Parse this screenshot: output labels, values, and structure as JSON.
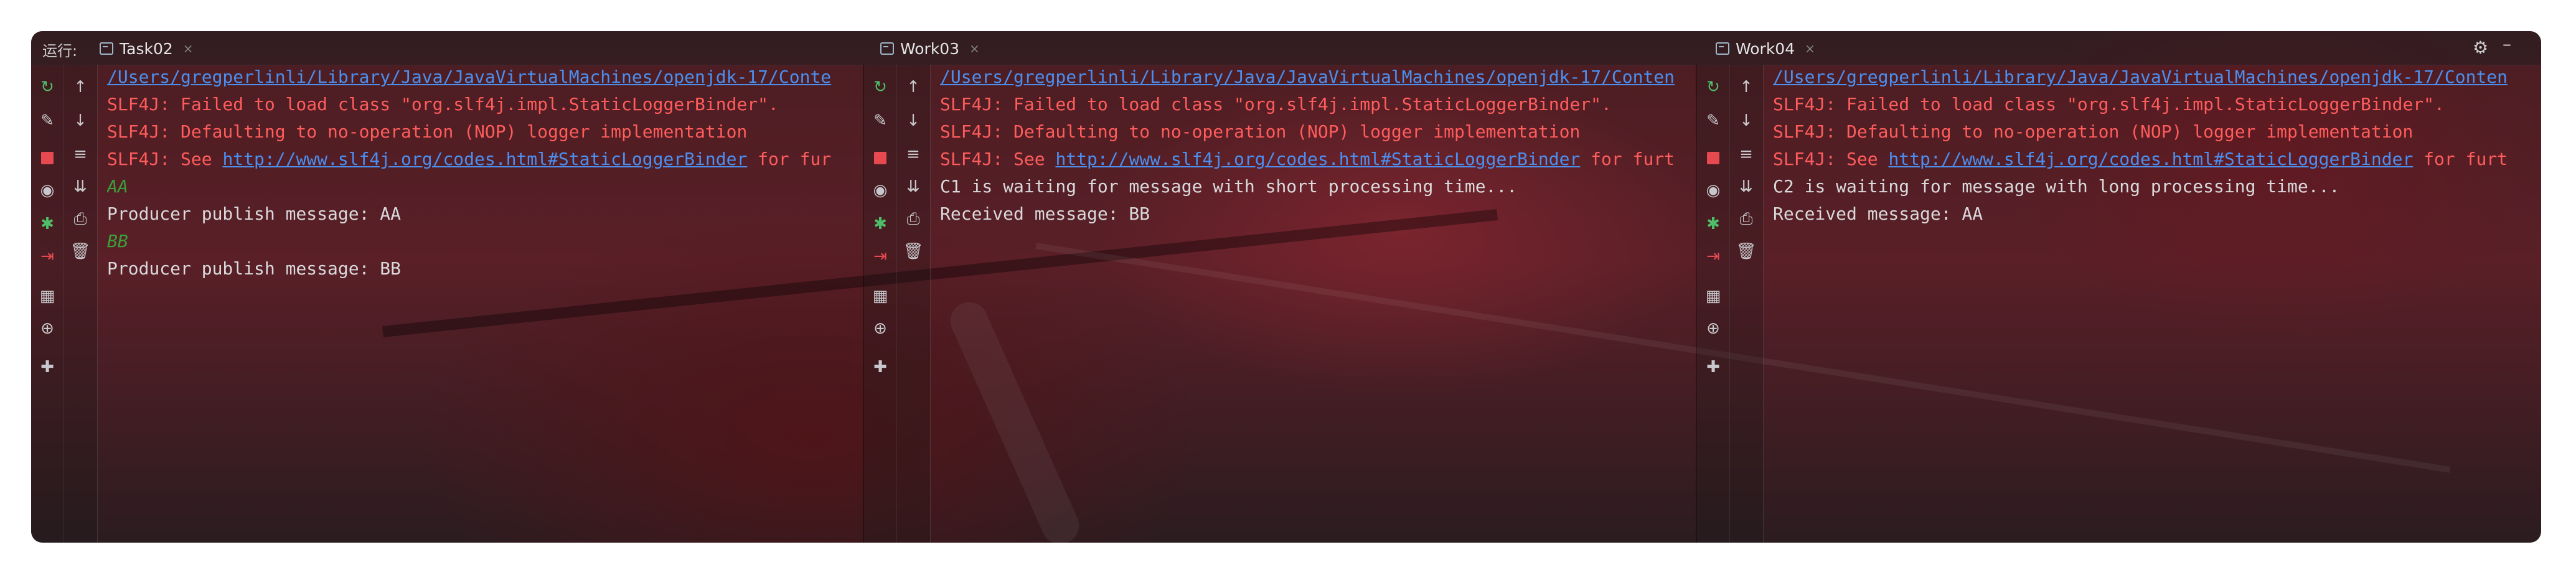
{
  "run_label": "运行:",
  "tabs": [
    {
      "label": "Task02",
      "close": "×"
    },
    {
      "label": "Work03",
      "close": "×"
    },
    {
      "label": "Work04",
      "close": "×"
    }
  ],
  "toolbar_right": {
    "settings_icon": "gear-icon",
    "minimize_icon": "minimize-icon"
  },
  "panels": [
    {
      "lines": [
        {
          "type": "path",
          "text": "/Users/gregperlinli/Library/Java/JavaVirtualMachines/openjdk-17/Conte"
        },
        {
          "type": "err",
          "text": "SLF4J: Failed to load class \"org.slf4j.impl.StaticLoggerBinder\"."
        },
        {
          "type": "err",
          "text": "SLF4J: Defaulting to no-operation (NOP) logger implementation"
        },
        {
          "type": "see",
          "prefix": "SLF4J: See ",
          "link": "http://www.slf4j.org/codes.html#StaticLoggerBinder",
          "suffix": " for fur"
        },
        {
          "type": "inp",
          "text": "AA"
        },
        {
          "type": "out",
          "text": "Producer publish message: AA"
        },
        {
          "type": "inp",
          "text": "BB"
        },
        {
          "type": "out",
          "text": "Producer publish message: BB"
        }
      ]
    },
    {
      "lines": [
        {
          "type": "path",
          "text": "/Users/gregperlinli/Library/Java/JavaVirtualMachines/openjdk-17/Conten"
        },
        {
          "type": "err",
          "text": "SLF4J: Failed to load class \"org.slf4j.impl.StaticLoggerBinder\"."
        },
        {
          "type": "err",
          "text": "SLF4J: Defaulting to no-operation (NOP) logger implementation"
        },
        {
          "type": "see",
          "prefix": "SLF4J: See ",
          "link": "http://www.slf4j.org/codes.html#StaticLoggerBinder",
          "suffix": " for furt"
        },
        {
          "type": "out",
          "text": "C1 is waiting for message with short processing time..."
        },
        {
          "type": "out",
          "text": "Received message: BB"
        }
      ]
    },
    {
      "lines": [
        {
          "type": "path",
          "text": "/Users/gregperlinli/Library/Java/JavaVirtualMachines/openjdk-17/Conten"
        },
        {
          "type": "err",
          "text": "SLF4J: Failed to load class \"org.slf4j.impl.StaticLoggerBinder\"."
        },
        {
          "type": "err",
          "text": "SLF4J: Defaulting to no-operation (NOP) logger implementation"
        },
        {
          "type": "see",
          "prefix": "SLF4J: See ",
          "link": "http://www.slf4j.org/codes.html#StaticLoggerBinder",
          "suffix": " for furt"
        },
        {
          "type": "out",
          "text": "C2 is waiting for message with long processing time..."
        },
        {
          "type": "out",
          "text": "Received message: AA"
        }
      ]
    }
  ],
  "gutter_a_icons": [
    "rerun-icon",
    "wrench-icon",
    "stop-icon",
    "camera-icon",
    "debug-bug-icon",
    "exit-icon",
    "layout-icon",
    "globe-icon",
    "pin-icon"
  ],
  "gutter_b_icons": [
    "arrow-up-icon",
    "arrow-down-icon",
    "soft-wrap-icon",
    "scroll-to-end-icon",
    "print-icon",
    "trash-icon"
  ],
  "colors": {
    "error": "#ff5c5c",
    "link": "#4b8ff0",
    "stdout": "#d9d9dc",
    "stdin": "#3aa03a",
    "stop": "#e64a50",
    "rerun": "#4fbe6a"
  }
}
